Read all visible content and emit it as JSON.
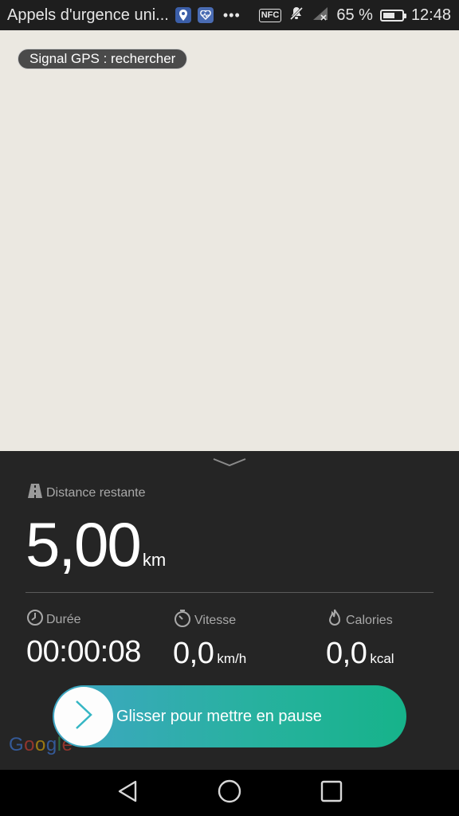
{
  "status_bar": {
    "title": "Appels d'urgence uni...",
    "battery_percent": "65 %",
    "battery_level": 0.65,
    "time": "12:48",
    "nfc_label": "NFC",
    "icons": [
      "maps-pin-icon",
      "health-icon",
      "more-icon",
      "nfc-icon",
      "mute-icon",
      "signal-icon",
      "battery-icon"
    ]
  },
  "map": {
    "gps_status": "Signal GPS : rechercher",
    "background_color": "#ebe8e1",
    "attribution": [
      "G",
      "o",
      "o",
      "g",
      "l",
      "e"
    ]
  },
  "panel": {
    "distance_label": "Distance restante",
    "distance_value": "5,00",
    "distance_unit": "km",
    "stats": [
      {
        "label": "Durée",
        "value": "00:00:08",
        "unit": "",
        "icon": "clock-icon"
      },
      {
        "label": "Vitesse",
        "value": "0,0",
        "unit": "km/h",
        "icon": "stopwatch-icon"
      },
      {
        "label": "Calories",
        "value": "0,0",
        "unit": "kcal",
        "icon": "flame-icon"
      }
    ],
    "slider_label": "Glisser pour mettre en pause",
    "accent_color": "#1fb393"
  },
  "navbar": {
    "buttons": [
      "back-icon",
      "home-icon",
      "recents-icon"
    ]
  }
}
